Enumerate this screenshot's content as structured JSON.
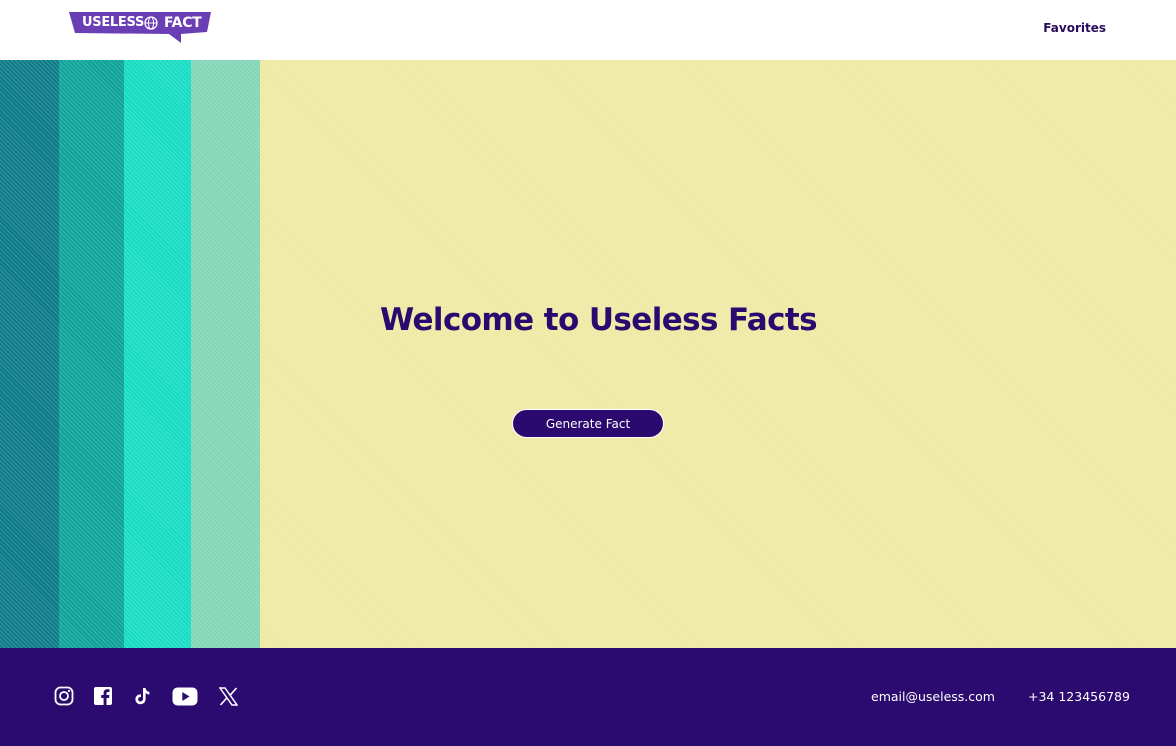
{
  "header": {
    "logo": {
      "text_first": "USELESS",
      "text_second": "FACT",
      "color": "#6a3fb5"
    },
    "nav": {
      "favorites_label": "Favorites"
    }
  },
  "hero": {
    "background_color": "#efe9a4",
    "stripes": [
      {
        "color": "#0b7b88"
      },
      {
        "color": "#0ea39a"
      },
      {
        "color": "#16dcc2"
      },
      {
        "color": "#82d6b7"
      }
    ],
    "title": "Welcome to Useless Facts",
    "generate_button_label": "Generate Fact"
  },
  "footer": {
    "background_color": "#2b0b70",
    "social_icons": [
      "instagram-icon",
      "facebook-icon",
      "tiktok-icon",
      "youtube-icon",
      "x-icon"
    ],
    "email": "email@useless.com",
    "phone": "+34 123456789"
  }
}
